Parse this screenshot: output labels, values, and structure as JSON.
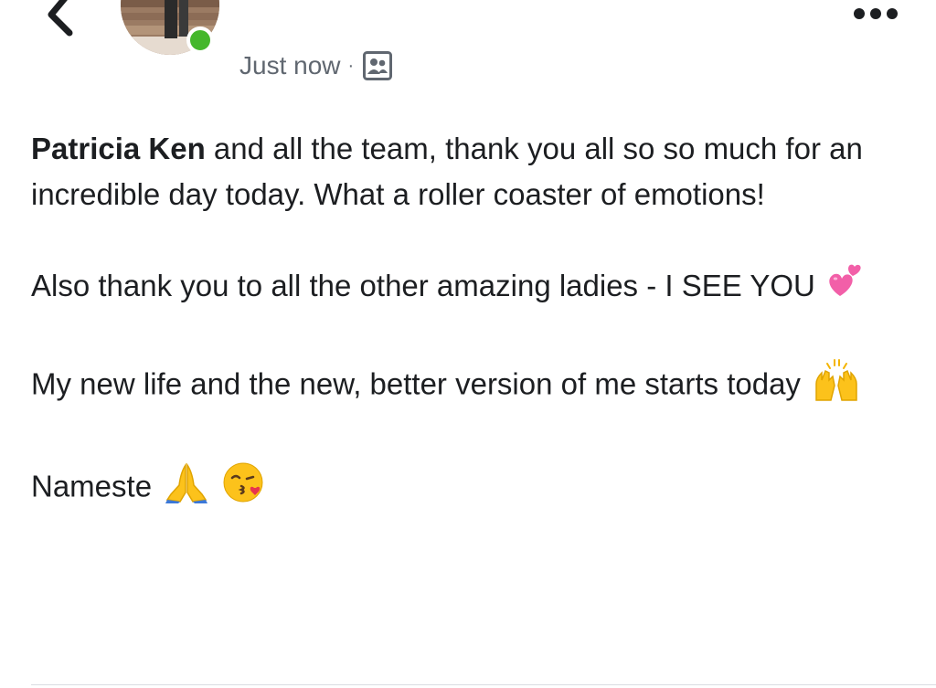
{
  "post": {
    "timestamp": "Just now",
    "separator": "·",
    "audience_icon": "friends-icon",
    "more_icon": "more-dots-icon",
    "back_icon": "back-chevron-icon",
    "online_status": "online",
    "mention": "Patricia Ken",
    "p1_text": " and all the team, thank you all so so much for an incredible day today. What a roller coaster of emotions!",
    "p2_text": "Also thank you to all the other amazing ladies - I SEE YOU",
    "p2_emoji": "two-hearts-emoji",
    "p3_text": "My new life and the new, better version of me starts today",
    "p3_emoji": "raising-hands-emoji",
    "p4_text": "Nameste",
    "p4_emojis": [
      "folded-hands-emoji",
      "kissing-face-emoji"
    ]
  },
  "colors": {
    "online": "#44b72b",
    "meta_text": "#606770",
    "body_text": "#1c1e21"
  }
}
